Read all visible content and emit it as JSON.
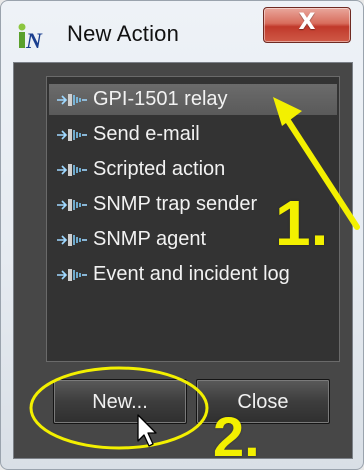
{
  "window": {
    "title": "New Action",
    "close_glyph": "X",
    "app_icon": "inet-logo-icon",
    "colors": {
      "titlebar": "#e6ebf1",
      "close_button": "#c0392b",
      "body": "#474747",
      "list_background": "#333333",
      "selected_row": "#5f5f5f",
      "text": "#f2f2f2",
      "annotation": "#f3f000"
    }
  },
  "action_list": {
    "item_icon": "action-connector-icon",
    "items": [
      {
        "label": "GPI-1501 relay",
        "selected": true
      },
      {
        "label": "Send e-mail",
        "selected": false
      },
      {
        "label": "Scripted action",
        "selected": false
      },
      {
        "label": "SNMP trap sender",
        "selected": false
      },
      {
        "label": "SNMP agent",
        "selected": false
      },
      {
        "label": "Event and incident log",
        "selected": false
      }
    ]
  },
  "buttons": {
    "new_label": "New...",
    "close_label": "Close"
  },
  "annotations": {
    "step_one": "1.",
    "step_two": "2."
  }
}
